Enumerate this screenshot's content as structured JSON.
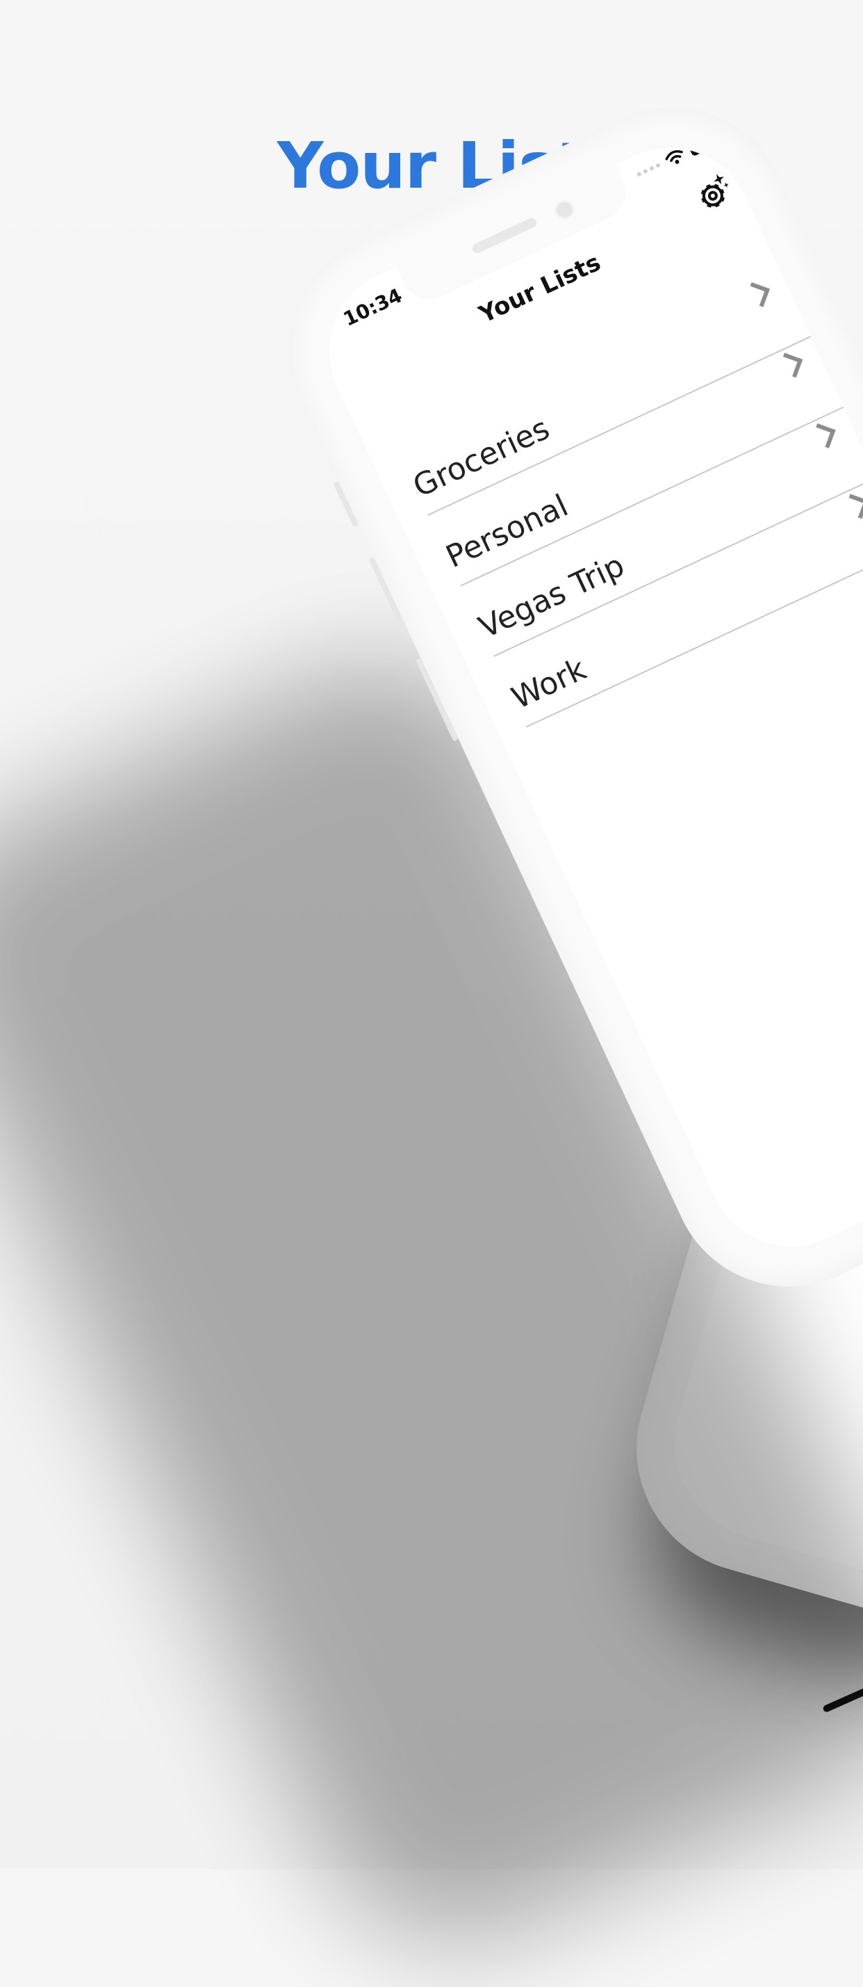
{
  "promo": {
    "headline": "Your List"
  },
  "phone": {
    "status_bar": {
      "time": "10:34"
    },
    "nav": {
      "title": "Your Lists",
      "settings_icon": "gear-sparkle-icon"
    },
    "lists": [
      {
        "label": "Groceries"
      },
      {
        "label": "Personal"
      },
      {
        "label": "Vegas Trip"
      },
      {
        "label": "Work"
      }
    ]
  },
  "colors": {
    "headline": "#2d78dd",
    "dots": "#1f1a57"
  }
}
